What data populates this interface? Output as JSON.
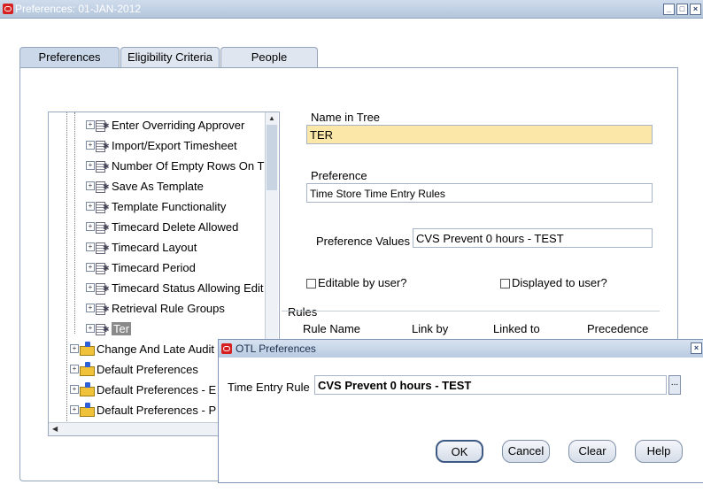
{
  "window": {
    "title": "Preferences: 01-JAN-2012"
  },
  "tabs": [
    "Preferences",
    "Eligibility Criteria",
    "People"
  ],
  "tree": {
    "children_items": [
      "Enter Overriding Approver",
      "Import/Export Timesheet",
      "Number Of Empty Rows On T",
      "Save As Template",
      "Template Functionality",
      "Timecard Delete Allowed",
      "Timecard Layout",
      "Timecard Period",
      "Timecard Status Allowing Edit",
      "Retrieval Rule Groups",
      "Ter"
    ],
    "folder_items": [
      "Change And Late Audit",
      "Default Preferences",
      "Default Preferences - E",
      "Default Preferences - P"
    ]
  },
  "form": {
    "name_in_tree_label": "Name in Tree",
    "name_in_tree_value": "TER",
    "preference_label": "Preference",
    "preference_value": "Time Store Time Entry Rules",
    "preference_values_label": "Preference Values",
    "preference_values_value": "CVS Prevent 0 hours - TEST",
    "editable_label": "Editable by user?",
    "displayed_label": "Displayed to user?"
  },
  "rules": {
    "section_label": "Rules",
    "columns": [
      "Rule Name",
      "Link by",
      "Linked to",
      "Precedence"
    ]
  },
  "dialog": {
    "title": "OTL Preferences",
    "time_entry_rule_label": "Time Entry Rule",
    "time_entry_rule_value": "CVS Prevent 0 hours - TEST",
    "lov_label": "...",
    "buttons": {
      "ok": "OK",
      "cancel": "Cancel",
      "clear": "Clear",
      "help": "Help"
    }
  },
  "colors": {
    "required_field": "#fbe8a8",
    "title_bar": "#b4c6dc"
  }
}
